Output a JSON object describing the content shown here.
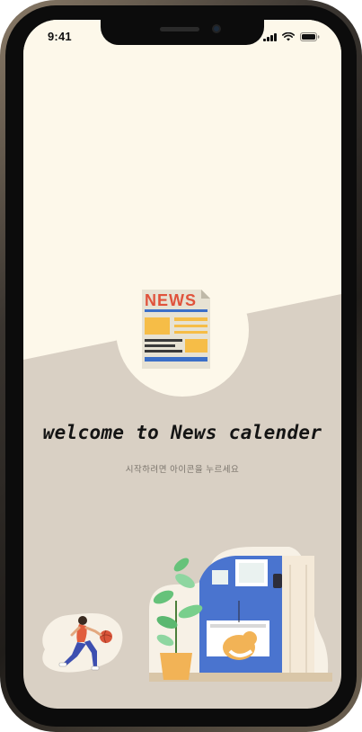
{
  "status_bar": {
    "time": "9:41",
    "icons": [
      "signal-icon",
      "wifi-icon",
      "battery-icon"
    ]
  },
  "app_icon": {
    "icon_name": "newspaper-icon",
    "text": "NEWS"
  },
  "welcome": {
    "title": "welcome to News calender",
    "subtitle": "시작하려면 아이콘을 누르세요"
  },
  "colors": {
    "background_top": "#fdf8ea",
    "background_bottom": "#d9d0c4",
    "accent_red": "#e0533c",
    "accent_yellow": "#f6bd47",
    "accent_blue": "#3b6fc8"
  },
  "illustrations": [
    "basketball-player-illustration",
    "plant-and-cat-room-illustration"
  ]
}
